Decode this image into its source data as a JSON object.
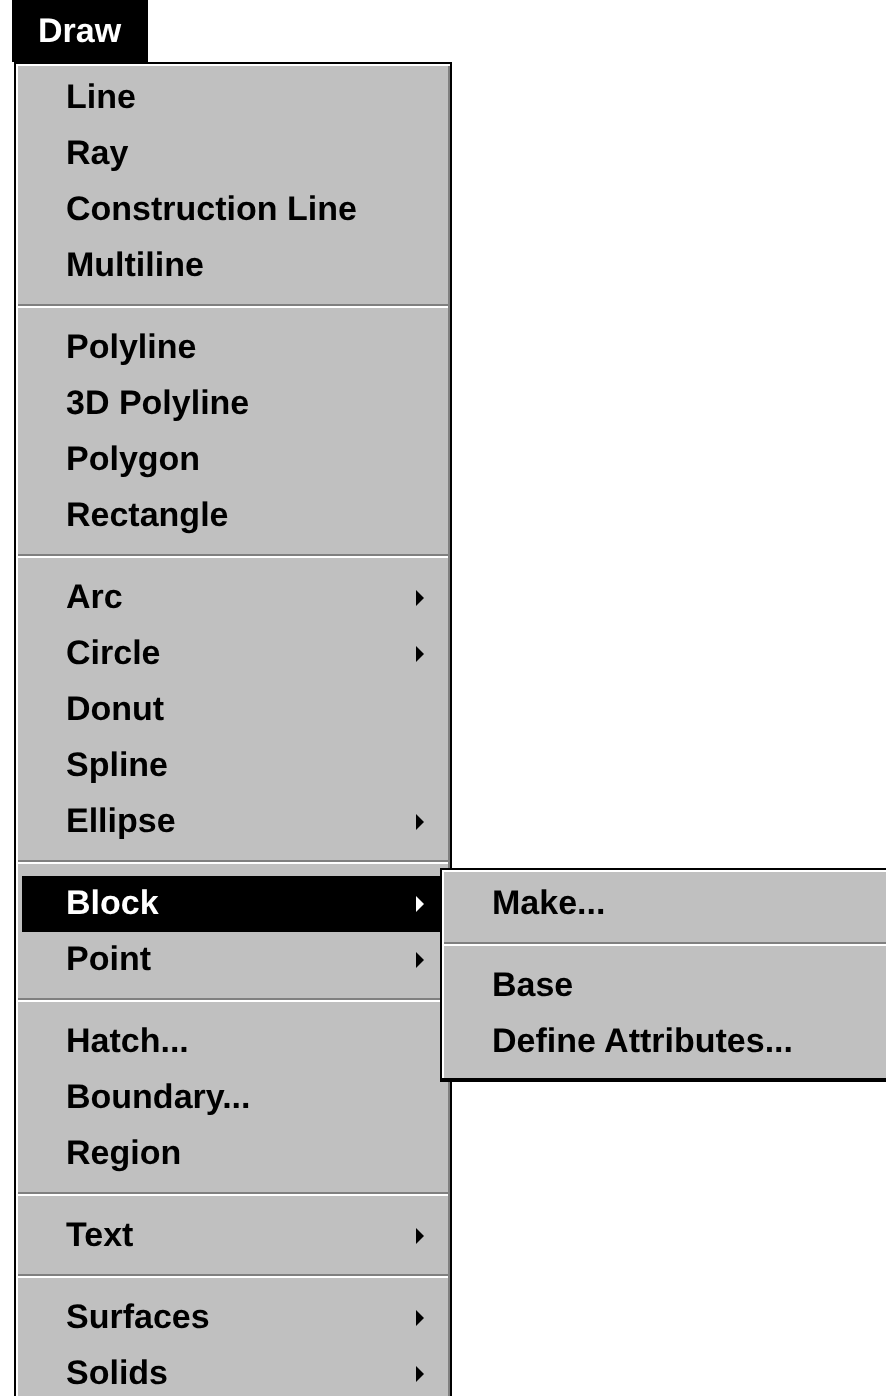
{
  "menubar": [
    {
      "label": "Draw",
      "selected": true
    }
  ],
  "menu": {
    "items": [
      {
        "kind": "item",
        "label": "Line",
        "has_submenu": false,
        "selected": false
      },
      {
        "kind": "item",
        "label": "Ray",
        "has_submenu": false,
        "selected": false
      },
      {
        "kind": "item",
        "label": "Construction Line",
        "has_submenu": false,
        "selected": false
      },
      {
        "kind": "item",
        "label": "Multiline",
        "has_submenu": false,
        "selected": false
      },
      {
        "kind": "separator"
      },
      {
        "kind": "item",
        "label": "Polyline",
        "has_submenu": false,
        "selected": false
      },
      {
        "kind": "item",
        "label": "3D Polyline",
        "has_submenu": false,
        "selected": false
      },
      {
        "kind": "item",
        "label": "Polygon",
        "has_submenu": false,
        "selected": false
      },
      {
        "kind": "item",
        "label": "Rectangle",
        "has_submenu": false,
        "selected": false
      },
      {
        "kind": "separator"
      },
      {
        "kind": "item",
        "label": "Arc",
        "has_submenu": true,
        "selected": false
      },
      {
        "kind": "item",
        "label": "Circle",
        "has_submenu": true,
        "selected": false
      },
      {
        "kind": "item",
        "label": "Donut",
        "has_submenu": false,
        "selected": false
      },
      {
        "kind": "item",
        "label": "Spline",
        "has_submenu": false,
        "selected": false
      },
      {
        "kind": "item",
        "label": "Ellipse",
        "has_submenu": true,
        "selected": false
      },
      {
        "kind": "separator"
      },
      {
        "kind": "item",
        "label": "Block",
        "has_submenu": true,
        "selected": true
      },
      {
        "kind": "item",
        "label": "Point",
        "has_submenu": true,
        "selected": false
      },
      {
        "kind": "separator"
      },
      {
        "kind": "item",
        "label": "Hatch...",
        "has_submenu": false,
        "selected": false
      },
      {
        "kind": "item",
        "label": "Boundary...",
        "has_submenu": false,
        "selected": false
      },
      {
        "kind": "item",
        "label": "Region",
        "has_submenu": false,
        "selected": false
      },
      {
        "kind": "separator"
      },
      {
        "kind": "item",
        "label": "Text",
        "has_submenu": true,
        "selected": false
      },
      {
        "kind": "separator"
      },
      {
        "kind": "item",
        "label": "Surfaces",
        "has_submenu": true,
        "selected": false
      },
      {
        "kind": "item",
        "label": "Solids",
        "has_submenu": true,
        "selected": false
      }
    ]
  },
  "submenu": {
    "items": [
      {
        "kind": "item",
        "label": "Make...",
        "has_submenu": false,
        "selected": false
      },
      {
        "kind": "separator"
      },
      {
        "kind": "item",
        "label": "Base",
        "has_submenu": false,
        "selected": false
      },
      {
        "kind": "item",
        "label": "Define Attributes...",
        "has_submenu": false,
        "selected": false
      }
    ]
  }
}
